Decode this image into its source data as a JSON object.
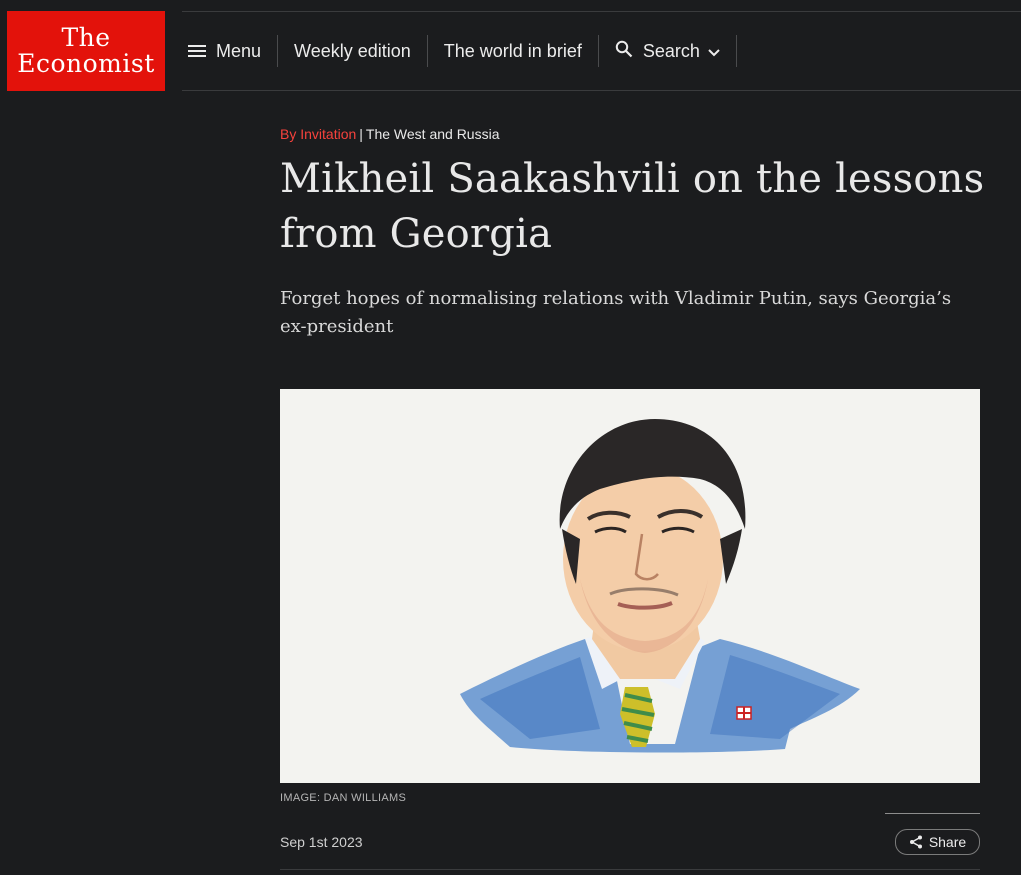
{
  "brand": {
    "line1": "The",
    "line2": "Economist",
    "color": "#e3120b"
  },
  "nav": {
    "menu": "Menu",
    "weekly": "Weekly edition",
    "brief": "The world in brief",
    "search": "Search"
  },
  "article": {
    "kicker_section": "By Invitation",
    "kicker_separator": "|",
    "kicker_topic": "The West and Russia",
    "headline": "Mikheil Saakashvili on the lessons from Georgia",
    "standfirst": "Forget hopes of normalising relations with Vladimir Putin, says Georgia’s ex-president",
    "image_credit": "IMAGE: DAN WILLIAMS",
    "date": "Sep 1st 2023",
    "share_label": "Share"
  },
  "icons": {
    "menu": "hamburger-icon",
    "search": "search-icon",
    "chevron": "chevron-down-icon",
    "share": "share-icon"
  },
  "colors": {
    "background": "#1b1c1e",
    "accent_red": "#f6423c"
  }
}
